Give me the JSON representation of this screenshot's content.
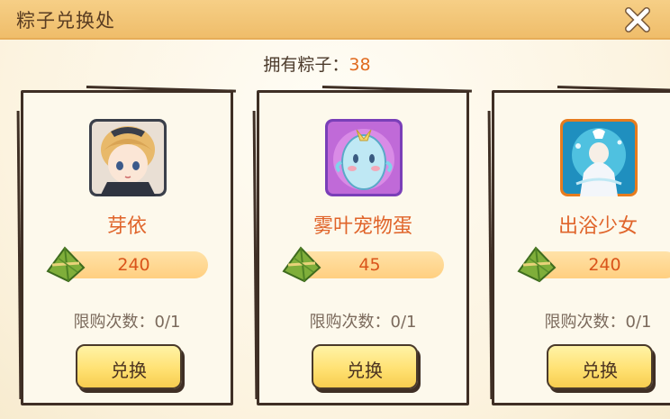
{
  "window": {
    "title": "粽子兑换处",
    "close_icon": "close-x-icon"
  },
  "currency": {
    "label": "拥有粽子：",
    "count": "38",
    "icon": "zongzi-icon"
  },
  "items": [
    {
      "name": "芽依",
      "cost": "240",
      "limit_label": "限购次数：",
      "limit_value": "0/1",
      "button_label": "兑换",
      "portrait": "girl-portrait-icon"
    },
    {
      "name": "雾叶宠物蛋",
      "cost": "45",
      "limit_label": "限购次数：",
      "limit_value": "0/1",
      "button_label": "兑换",
      "portrait": "pet-egg-icon"
    },
    {
      "name": "出浴少女",
      "cost": "240",
      "limit_label": "限购次数：",
      "limit_value": "0/1",
      "button_label": "兑换",
      "portrait": "bathing-girl-icon"
    }
  ],
  "colors": {
    "title_bar": "#efbd6a",
    "accent_orange": "#e0642a",
    "button_yellow": "#ffe173",
    "card_border": "#3f2f25"
  }
}
